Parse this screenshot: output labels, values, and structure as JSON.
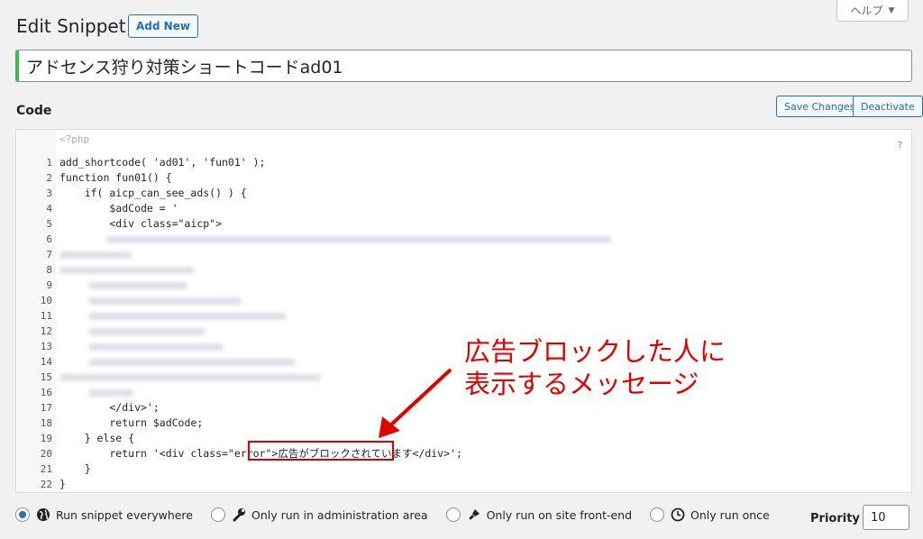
{
  "help": {
    "label": "ヘルプ",
    "caret": "▼"
  },
  "header": {
    "title": "Edit Snippet",
    "add_new": "Add New"
  },
  "snippet": {
    "name": "アドセンス狩り対策ショートコードad01"
  },
  "code_section": {
    "heading": "Code",
    "save_label": "Save Changes",
    "deactivate_label": "Deactivate"
  },
  "editor": {
    "open_tag": "<?php",
    "help_mark": "?",
    "lines": [
      {
        "num": "1",
        "text": "add_shortcode( 'ad01', 'fun01' );"
      },
      {
        "num": "2",
        "text": "function fun01() {"
      },
      {
        "num": "3",
        "text": "    if( aicp_can_see_ads() ) {"
      },
      {
        "num": "4",
        "text": "        $adCode = '"
      },
      {
        "num": "5",
        "text": "        <div class=\"aicp\">"
      },
      {
        "num": "6",
        "text": ""
      },
      {
        "num": "7",
        "text": ""
      },
      {
        "num": "8",
        "text": ""
      },
      {
        "num": "9",
        "text": ""
      },
      {
        "num": "10",
        "text": ""
      },
      {
        "num": "11",
        "text": ""
      },
      {
        "num": "12",
        "text": ""
      },
      {
        "num": "13",
        "text": ""
      },
      {
        "num": "14",
        "text": ""
      },
      {
        "num": "15",
        "text": ""
      },
      {
        "num": "16",
        "text": ""
      },
      {
        "num": "17",
        "text": "        </div>';"
      },
      {
        "num": "18",
        "text": "        return $adCode;"
      },
      {
        "num": "19",
        "text": "    } else {"
      },
      {
        "num": "20",
        "text": "        return '<div class=\"error\">広告がブロックされています</div>';"
      },
      {
        "num": "21",
        "text": "    }"
      },
      {
        "num": "22",
        "text": "}"
      }
    ]
  },
  "annotation": {
    "line1": "広告ブロックした人に",
    "line2": "表示するメッセージ",
    "color": "#e00000"
  },
  "run_options": [
    {
      "label": "Run snippet everywhere",
      "icon": "globe-icon",
      "checked": true
    },
    {
      "label": "Only run in administration area",
      "icon": "wrench-icon",
      "checked": false
    },
    {
      "label": "Only run on site front-end",
      "icon": "paintbrush-icon",
      "checked": false
    },
    {
      "label": "Only run once",
      "icon": "clock-icon",
      "checked": false
    }
  ],
  "priority": {
    "label": "Priority",
    "value": "10"
  },
  "colors": {
    "accent": "#2271b1",
    "active_border": "#46b450"
  }
}
